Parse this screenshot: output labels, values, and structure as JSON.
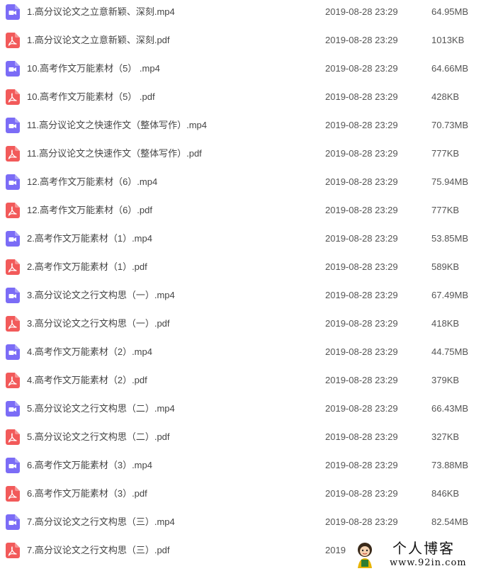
{
  "files": [
    {
      "type": "video",
      "icon": "video-file-icon",
      "name": "1.高分议论文之立意新颖、深刻.mp4",
      "date": "2019-08-28 23:29",
      "size": "64.95MB"
    },
    {
      "type": "pdf",
      "icon": "pdf-file-icon",
      "name": "1.高分议论文之立意新颖、深刻.pdf",
      "date": "2019-08-28 23:29",
      "size": "1013KB"
    },
    {
      "type": "video",
      "icon": "video-file-icon",
      "name": "10.高考作文万能素材（5） .mp4",
      "date": "2019-08-28 23:29",
      "size": "64.66MB"
    },
    {
      "type": "pdf",
      "icon": "pdf-file-icon",
      "name": "10.高考作文万能素材（5） .pdf",
      "date": "2019-08-28 23:29",
      "size": "428KB"
    },
    {
      "type": "video",
      "icon": "video-file-icon",
      "name": "11.高分议论文之快速作文（整体写作）.mp4",
      "date": "2019-08-28 23:29",
      "size": "70.73MB"
    },
    {
      "type": "pdf",
      "icon": "pdf-file-icon",
      "name": "11.高分议论文之快速作文（整体写作）.pdf",
      "date": "2019-08-28 23:29",
      "size": "777KB"
    },
    {
      "type": "video",
      "icon": "video-file-icon",
      "name": "12.高考作文万能素材（6）.mp4",
      "date": "2019-08-28 23:29",
      "size": "75.94MB"
    },
    {
      "type": "pdf",
      "icon": "pdf-file-icon",
      "name": "12.高考作文万能素材（6）.pdf",
      "date": "2019-08-28 23:29",
      "size": "777KB"
    },
    {
      "type": "video",
      "icon": "video-file-icon",
      "name": "2.高考作文万能素材（1）.mp4",
      "date": "2019-08-28 23:29",
      "size": "53.85MB"
    },
    {
      "type": "pdf",
      "icon": "pdf-file-icon",
      "name": "2.高考作文万能素材（1）.pdf",
      "date": "2019-08-28 23:29",
      "size": "589KB"
    },
    {
      "type": "video",
      "icon": "video-file-icon",
      "name": "3.高分议论文之行文构思（一）.mp4",
      "date": "2019-08-28 23:29",
      "size": "67.49MB"
    },
    {
      "type": "pdf",
      "icon": "pdf-file-icon",
      "name": "3.高分议论文之行文构思（一）.pdf",
      "date": "2019-08-28 23:29",
      "size": "418KB"
    },
    {
      "type": "video",
      "icon": "video-file-icon",
      "name": "4.高考作文万能素材（2）.mp4",
      "date": "2019-08-28 23:29",
      "size": "44.75MB"
    },
    {
      "type": "pdf",
      "icon": "pdf-file-icon",
      "name": "4.高考作文万能素材（2）.pdf",
      "date": "2019-08-28 23:29",
      "size": "379KB"
    },
    {
      "type": "video",
      "icon": "video-file-icon",
      "name": "5.高分议论文之行文构思（二）.mp4",
      "date": "2019-08-28 23:29",
      "size": "66.43MB"
    },
    {
      "type": "pdf",
      "icon": "pdf-file-icon",
      "name": "5.高分议论文之行文构思（二）.pdf",
      "date": "2019-08-28 23:29",
      "size": "327KB"
    },
    {
      "type": "video",
      "icon": "video-file-icon",
      "name": "6.高考作文万能素材（3）.mp4",
      "date": "2019-08-28 23:29",
      "size": "73.88MB"
    },
    {
      "type": "pdf",
      "icon": "pdf-file-icon",
      "name": "6.高考作文万能素材（3）.pdf",
      "date": "2019-08-28 23:29",
      "size": "846KB"
    },
    {
      "type": "video",
      "icon": "video-file-icon",
      "name": "7.高分议论文之行文构思（三）.mp4",
      "date": "2019-08-28 23:29",
      "size": "82.54MB"
    },
    {
      "type": "pdf",
      "icon": "pdf-file-icon",
      "name": "7.高分议论文之行文构思（三）.pdf",
      "date": "2019",
      "size": ""
    }
  ],
  "colors": {
    "video_icon": "#7b6cf6",
    "pdf_icon": "#f25a5a"
  },
  "watermark": {
    "title": "个人博客",
    "url": "www.92in.com"
  }
}
